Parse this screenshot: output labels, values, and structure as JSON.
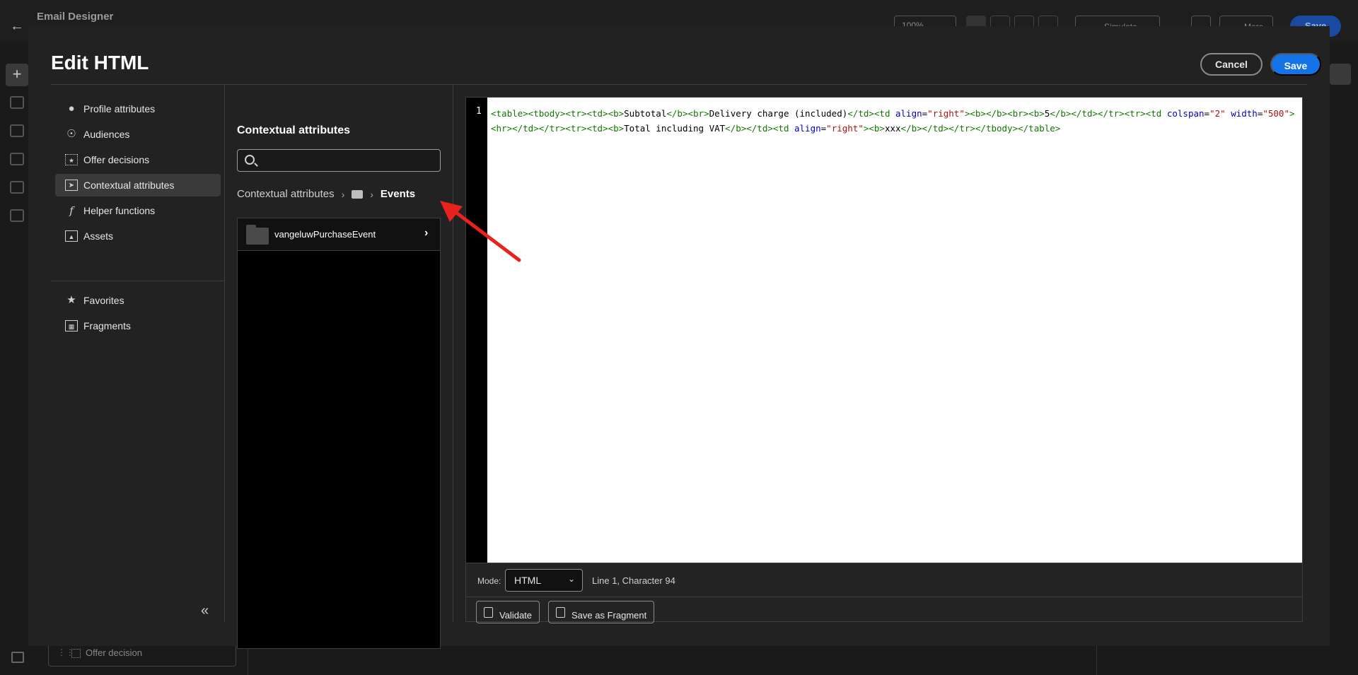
{
  "background": {
    "app_title": "Email Designer",
    "zoom": "100%",
    "simulate_label": "Simulate Content",
    "more_label": "More",
    "save_label": "Save",
    "offer_decision_label": "Offer decision"
  },
  "modal": {
    "title": "Edit HTML",
    "cancel_label": "Cancel",
    "save_label": "Save"
  },
  "nav": {
    "items": [
      {
        "label": "Profile attributes",
        "icon": "person-icon"
      },
      {
        "label": "Audiences",
        "icon": "audience-icon"
      },
      {
        "label": "Offer decisions",
        "icon": "offer-icon"
      },
      {
        "label": "Contextual attributes",
        "icon": "contextual-icon",
        "active": true
      },
      {
        "label": "Helper functions",
        "icon": "function-icon"
      },
      {
        "label": "Assets",
        "icon": "image-icon"
      },
      {
        "label": "Favorites",
        "icon": "star-icon"
      },
      {
        "label": "Fragments",
        "icon": "fragment-icon"
      }
    ]
  },
  "panel": {
    "title": "Contextual attributes",
    "search_placeholder": "",
    "breadcrumb": {
      "root": "Contextual attributes",
      "current": "Events"
    },
    "items": [
      {
        "label": "vangeluwPurchaseEvent"
      }
    ]
  },
  "editor": {
    "line_number": "1",
    "mode_label": "Mode:",
    "mode_value": "HTML",
    "cursor_position": "Line 1, Character 94",
    "validate_label": "Validate",
    "save_fragment_label": "Save as Fragment"
  },
  "colors": {
    "accent": "#1473e6",
    "arrow": "#e8221c"
  }
}
